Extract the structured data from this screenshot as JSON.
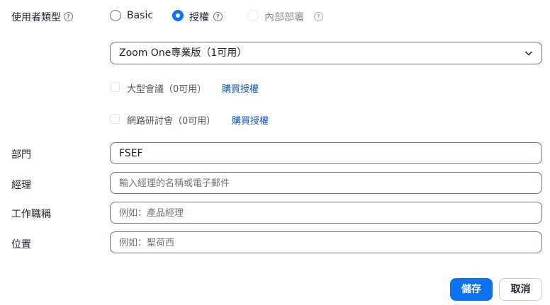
{
  "user_type": {
    "label": "使用者類型",
    "help": "?",
    "options": [
      {
        "label": "Basic",
        "selected": false,
        "disabled": false
      },
      {
        "label": "授權",
        "selected": true,
        "disabled": false,
        "help": "?"
      },
      {
        "label": "內部部署",
        "selected": false,
        "disabled": true,
        "help": "?"
      }
    ]
  },
  "license_select": {
    "value": "Zoom One專業版（1可用）",
    "icon": "chevron-down-icon"
  },
  "addons": [
    {
      "label": "大型會議（0可用）",
      "link": "購買授權",
      "checked": false
    },
    {
      "label": "網路研討會（0可用）",
      "link": "購買授權",
      "checked": false
    }
  ],
  "fields": {
    "department": {
      "label": "部門",
      "value": "FSEF",
      "placeholder": ""
    },
    "manager": {
      "label": "經理",
      "value": "",
      "placeholder": "輸入經理的名稱或電子郵件"
    },
    "job_title": {
      "label": "工作職稱",
      "value": "",
      "placeholder": "例如：產品經理"
    },
    "location": {
      "label": "位置",
      "value": "",
      "placeholder": "例如：聖荷西"
    }
  },
  "buttons": {
    "save": "儲存",
    "cancel": "取消"
  },
  "colors": {
    "accent": "#0e72ed",
    "link": "#0e56b8",
    "border": "#6e7680"
  }
}
